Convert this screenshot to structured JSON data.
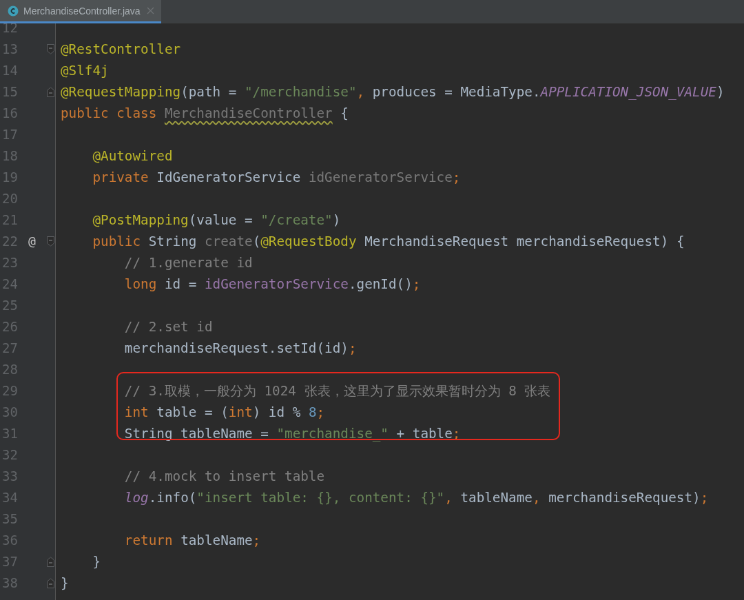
{
  "tab": {
    "title": "MerchandiseController.java",
    "selected": true
  },
  "lines": [
    {
      "n": "12"
    },
    {
      "n": "13",
      "fold_open": true,
      "tokens": [
        {
          "kind": "ann",
          "t": "@RestController"
        }
      ]
    },
    {
      "n": "14",
      "tokens": [
        {
          "kind": "ann",
          "t": "@Slf4j"
        }
      ]
    },
    {
      "n": "15",
      "fold_close": true,
      "tokens": [
        {
          "kind": "ann",
          "t": "@RequestMapping"
        },
        {
          "kind": "plain",
          "t": "(path = "
        },
        {
          "kind": "str",
          "t": "\"/merchandise\""
        },
        {
          "kind": "kw",
          "t": ", "
        },
        {
          "kind": "plain",
          "t": "produces = MediaType."
        },
        {
          "kind": "const",
          "t": "APPLICATION_JSON_VALUE"
        },
        {
          "kind": "plain",
          "t": ")"
        }
      ]
    },
    {
      "n": "16",
      "tokens": [
        {
          "kind": "kw",
          "t": "public class "
        },
        {
          "kind": "warn",
          "t": "MerchandiseController"
        },
        {
          "kind": "plain",
          "t": " {"
        }
      ]
    },
    {
      "n": "17"
    },
    {
      "n": "18",
      "tokens": [
        {
          "kind": "ann",
          "t": "    @Autowired"
        }
      ]
    },
    {
      "n": "19",
      "tokens": [
        {
          "kind": "kw",
          "t": "    private "
        },
        {
          "kind": "plain",
          "t": "IdGeneratorService "
        },
        {
          "kind": "unused",
          "t": "idGeneratorService"
        },
        {
          "kind": "kw",
          "t": ";"
        }
      ]
    },
    {
      "n": "20"
    },
    {
      "n": "21",
      "tokens": [
        {
          "kind": "ann",
          "t": "    @PostMapping"
        },
        {
          "kind": "plain",
          "t": "(value = "
        },
        {
          "kind": "str",
          "t": "\"/create\""
        },
        {
          "kind": "plain",
          "t": ")"
        }
      ]
    },
    {
      "n": "22",
      "marker": "@",
      "fold_open": true,
      "tokens": [
        {
          "kind": "kw",
          "t": "    public "
        },
        {
          "kind": "plain",
          "t": "String "
        },
        {
          "kind": "unused",
          "t": "create"
        },
        {
          "kind": "plain",
          "t": "("
        },
        {
          "kind": "ann",
          "t": "@RequestBody "
        },
        {
          "kind": "plain",
          "t": "MerchandiseRequest merchandiseRequest) {"
        }
      ]
    },
    {
      "n": "23",
      "tokens": [
        {
          "kind": "comment",
          "t": "        // 1.generate id"
        }
      ]
    },
    {
      "n": "24",
      "tokens": [
        {
          "kind": "kw",
          "t": "        long "
        },
        {
          "kind": "plain",
          "t": "id = "
        },
        {
          "kind": "field",
          "t": "idGeneratorService"
        },
        {
          "kind": "plain",
          "t": ".genId()"
        },
        {
          "kind": "kw",
          "t": ";"
        }
      ]
    },
    {
      "n": "25"
    },
    {
      "n": "26",
      "tokens": [
        {
          "kind": "comment",
          "t": "        // 2.set id"
        }
      ]
    },
    {
      "n": "27",
      "tokens": [
        {
          "kind": "plain",
          "t": "        merchandiseRequest.setId(id)"
        },
        {
          "kind": "kw",
          "t": ";"
        }
      ]
    },
    {
      "n": "28"
    },
    {
      "n": "29",
      "boxed": true,
      "tokens": [
        {
          "kind": "comment",
          "t": "        // 3.取模，一般分为 1024 张表，这里为了显示效果暂时分为 8 张表"
        }
      ]
    },
    {
      "n": "30",
      "boxed": true,
      "tokens": [
        {
          "kind": "kw",
          "t": "        int "
        },
        {
          "kind": "plain",
          "t": "table = ("
        },
        {
          "kind": "kw",
          "t": "int"
        },
        {
          "kind": "plain",
          "t": ") id % "
        },
        {
          "kind": "num",
          "t": "8"
        },
        {
          "kind": "kw",
          "t": ";"
        }
      ]
    },
    {
      "n": "31",
      "boxed": true,
      "tokens": [
        {
          "kind": "plain",
          "t": "        String tableName = "
        },
        {
          "kind": "str",
          "t": "\"merchandise_\""
        },
        {
          "kind": "plain",
          "t": " + table"
        },
        {
          "kind": "kw",
          "t": ";"
        }
      ]
    },
    {
      "n": "32"
    },
    {
      "n": "33",
      "tokens": [
        {
          "kind": "comment",
          "t": "        // 4.mock to insert table"
        }
      ]
    },
    {
      "n": "34",
      "tokens": [
        {
          "kind": "fieldi",
          "t": "        log"
        },
        {
          "kind": "plain",
          "t": ".info("
        },
        {
          "kind": "str",
          "t": "\"insert table: {}, content: {}\""
        },
        {
          "kind": "kw",
          "t": ", "
        },
        {
          "kind": "plain",
          "t": "tableName"
        },
        {
          "kind": "kw",
          "t": ", "
        },
        {
          "kind": "plain",
          "t": "merchandiseRequest)"
        },
        {
          "kind": "kw",
          "t": ";"
        }
      ]
    },
    {
      "n": "35"
    },
    {
      "n": "36",
      "tokens": [
        {
          "kind": "kw",
          "t": "        return "
        },
        {
          "kind": "plain",
          "t": "tableName"
        },
        {
          "kind": "kw",
          "t": ";"
        }
      ]
    },
    {
      "n": "37",
      "fold_close": true,
      "tokens": [
        {
          "kind": "plain",
          "t": "    }"
        }
      ]
    },
    {
      "n": "38",
      "fold_close": true,
      "tokens": [
        {
          "kind": "plain",
          "t": "}"
        }
      ]
    }
  ]
}
